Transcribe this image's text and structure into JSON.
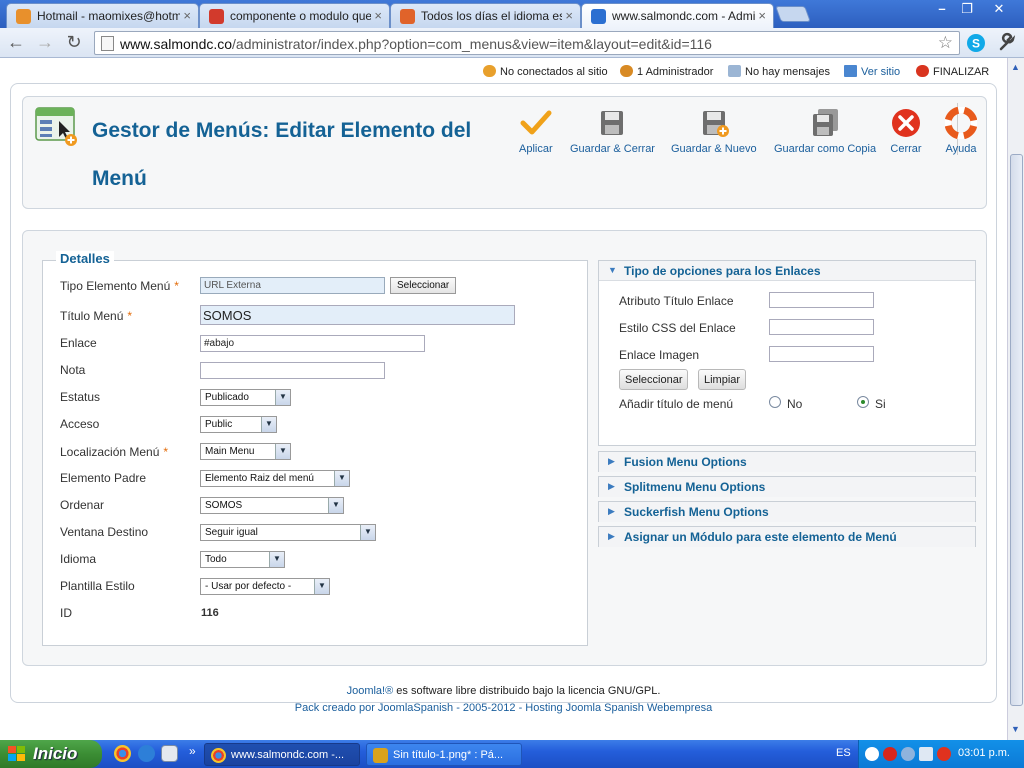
{
  "browser": {
    "tabs": [
      {
        "title": "Hotmail - maomixes@hotmail.",
        "color": "#e8902c"
      },
      {
        "title": "componente o modulo que de",
        "color": "#d23a2c"
      },
      {
        "title": "Todos los días el idioma españ",
        "color": "#e0632a"
      },
      {
        "title": "www.salmondc.com - Adminis",
        "color": "#2b6fd1"
      }
    ],
    "url_host": "www.salmondc.co",
    "url_path": "/administrator/index.php?option=com_menus&view=item&layout=edit&id=116"
  },
  "statusbar": {
    "not_connected": "No conectados al sitio",
    "admin": "1 Administrador",
    "messages": "No hay mensajes",
    "view_site": "Ver sitio",
    "logout": "FINALIZAR"
  },
  "header": {
    "title": "Gestor de Menús: Editar Elemento del Menú"
  },
  "toolbar": {
    "apply": "Aplicar",
    "save_close": "Guardar & Cerrar",
    "save_new": "Guardar & Nuevo",
    "save_copy": "Guardar como Copia",
    "close": "Cerrar",
    "help": "Ayuda"
  },
  "details": {
    "legend": "Detalles",
    "type_label": "Tipo Elemento Menú",
    "type_value": "URL Externa",
    "select_button": "Seleccionar",
    "title_label": "Título Menú",
    "title_value": "SOMOS",
    "link_label": "Enlace",
    "link_value": "#abajo",
    "note_label": "Nota",
    "note_value": "",
    "status_label": "Estatus",
    "status_value": "Publicado",
    "access_label": "Acceso",
    "access_value": "Public",
    "location_label": "Localización Menú",
    "location_value": "Main Menu",
    "parent_label": "Elemento Padre",
    "parent_value": "Elemento Raiz del menú",
    "order_label": "Ordenar",
    "order_value": "SOMOS",
    "target_label": "Ventana Destino",
    "target_value": "Seguir igual",
    "language_label": "Idioma",
    "language_value": "Todo",
    "template_label": "Plantilla Estilo",
    "template_value": "- Usar por defecto -",
    "id_label": "ID",
    "id_value": "116",
    "required_mark": "*"
  },
  "link_options": {
    "heading": "Tipo de opciones para los Enlaces",
    "title_attr_label": "Atributo Título Enlace",
    "css_label": "Estilo CSS del Enlace",
    "image_label": "Enlace Imagen",
    "select_button": "Seleccionar",
    "clear_button": "Limpiar",
    "add_title_label": "Añadir título de menú",
    "no_label": "No",
    "yes_label": "Si",
    "add_title_selected": "Si"
  },
  "collapsed_panels": [
    "Fusion Menu Options",
    "Splitmenu Menu Options",
    "Suckerfish Menu Options",
    "Asignar un Módulo para este elemento de Menú"
  ],
  "footer": {
    "joomla": "Joomla!®",
    "license": " es software libre distribuido bajo la licencia GNU/GPL.",
    "credits": "Pack creado por JoomlaSpanish - 2005-2012 - Hosting Joomla Spanish Webempresa"
  },
  "taskbar": {
    "start": "Inicio",
    "chevron": "»",
    "tasks": [
      {
        "label": "www.salmondc.com -...",
        "color": "#2f8be0"
      },
      {
        "label": "Sin título-1.png* : Pá...",
        "color": "#d9a21c"
      }
    ],
    "lang": "ES",
    "clock": "03:01 p.m."
  },
  "colors": {
    "accent": "#146295",
    "link": "#1a5e9c",
    "required": "#e36c0a"
  }
}
